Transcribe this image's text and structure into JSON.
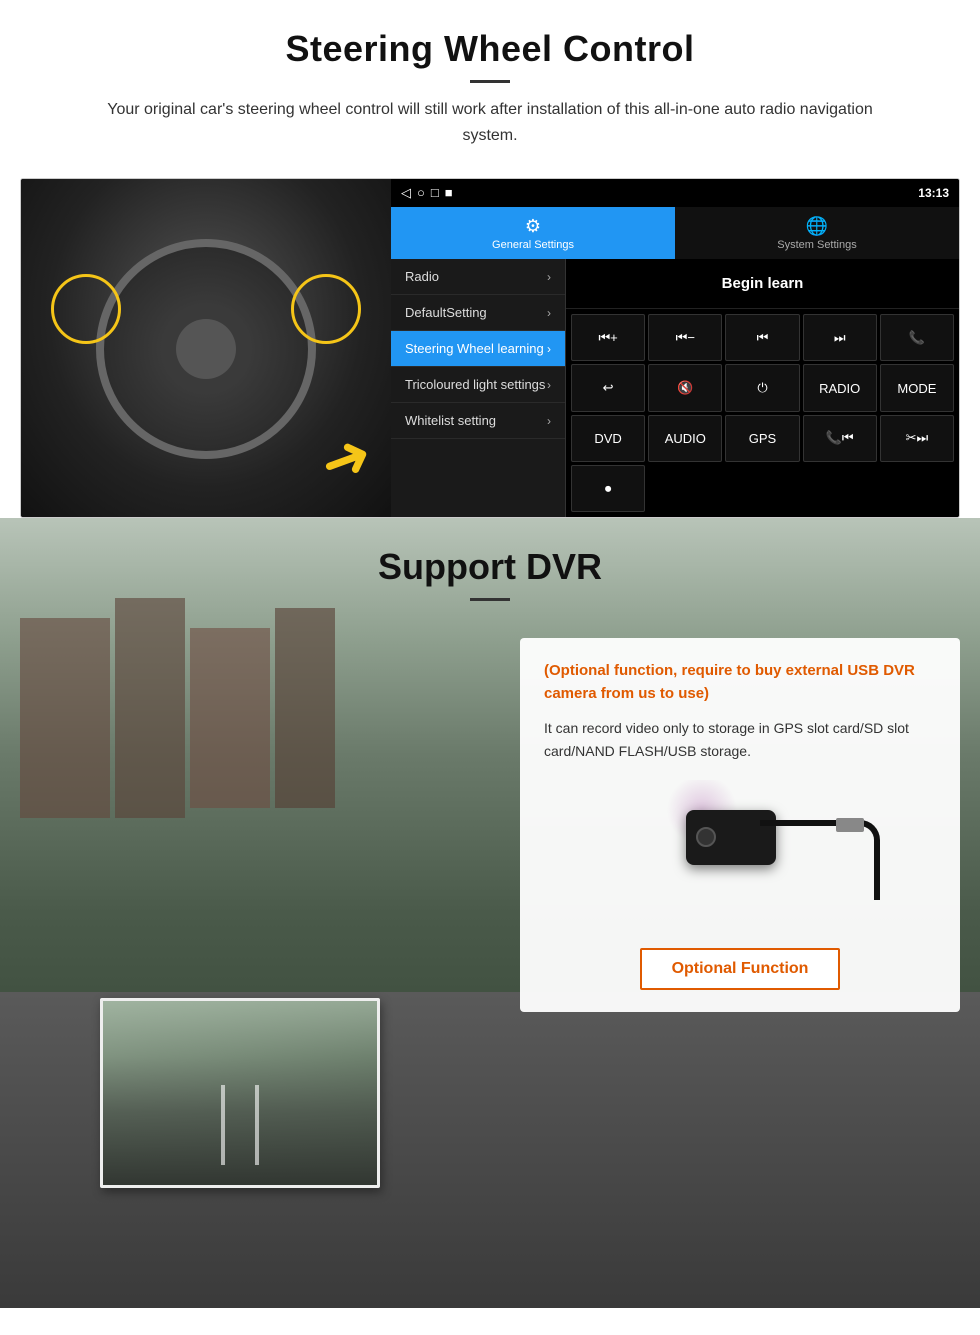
{
  "section1": {
    "title": "Steering Wheel Control",
    "subtitle": "Your original car's steering wheel control will still work after installation of this all-in-one auto radio navigation system.",
    "statusbar": {
      "icons": [
        "◁",
        "○",
        "□",
        "■"
      ],
      "right": "13:13"
    },
    "tabs": {
      "general": "General Settings",
      "system": "System Settings"
    },
    "menu": {
      "items": [
        {
          "label": "Radio",
          "active": false
        },
        {
          "label": "DefaultSetting",
          "active": false
        },
        {
          "label": "Steering Wheel learning",
          "active": true
        },
        {
          "label": "Tricoloured light settings",
          "active": false
        },
        {
          "label": "Whitelist setting",
          "active": false
        }
      ]
    },
    "begin_learn": "Begin learn",
    "controls": [
      {
        "label": "⏮+",
        "row": 1
      },
      {
        "label": "⏮−",
        "row": 1
      },
      {
        "label": "⏮",
        "row": 1
      },
      {
        "label": "⏭",
        "row": 1
      },
      {
        "label": "📞",
        "row": 1
      },
      {
        "label": "↩",
        "row": 2
      },
      {
        "label": "🔇",
        "row": 2
      },
      {
        "label": "⏻",
        "row": 2
      },
      {
        "label": "RADIO",
        "row": 2
      },
      {
        "label": "MODE",
        "row": 2
      },
      {
        "label": "DVD",
        "row": 3
      },
      {
        "label": "AUDIO",
        "row": 3
      },
      {
        "label": "GPS",
        "row": 3
      },
      {
        "label": "📞⏮",
        "row": 3
      },
      {
        "label": "✂⏭",
        "row": 3
      },
      {
        "label": "⏺",
        "row": 4
      }
    ]
  },
  "section2": {
    "title": "Support DVR",
    "card": {
      "optional_heading": "(Optional function, require to buy external USB DVR camera from us to use)",
      "description": "It can record video only to storage in GPS slot card/SD slot card/NAND FLASH/USB storage.",
      "button_label": "Optional Function"
    }
  }
}
